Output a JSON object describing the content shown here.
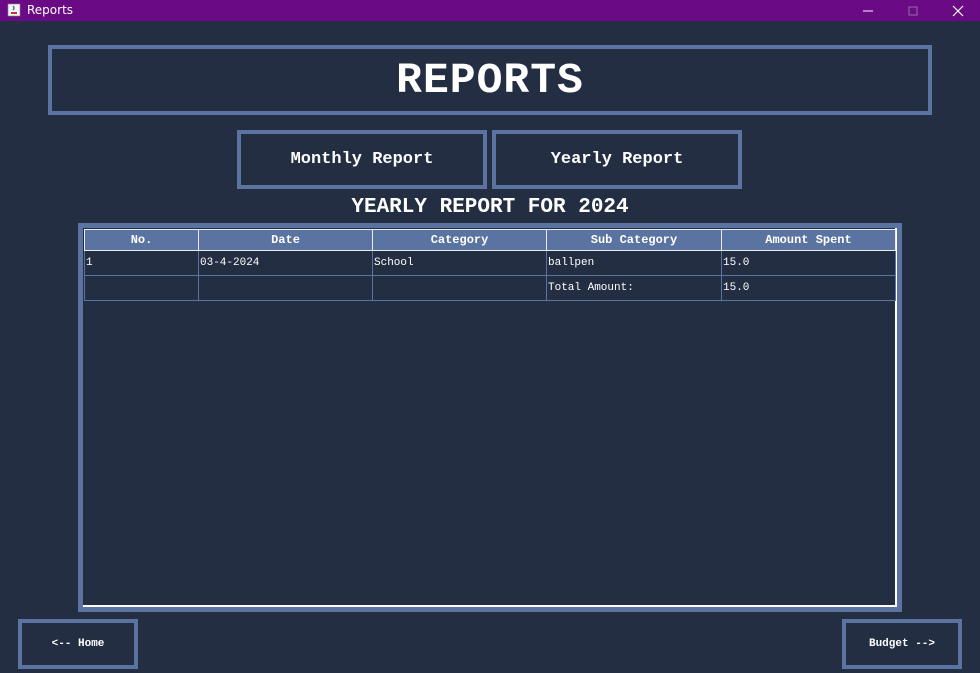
{
  "window": {
    "title": "Reports",
    "controls": {
      "minimize": "minimize-icon",
      "maximize": "maximize-icon",
      "close": "close-icon"
    }
  },
  "header": {
    "title": "REPORTS"
  },
  "tabs": {
    "monthly_label": "Monthly Report",
    "yearly_label": "Yearly Report"
  },
  "report": {
    "heading": "YEARLY REPORT FOR 2024",
    "columns": [
      "No.",
      "Date",
      "Category",
      "Sub Category",
      "Amount Spent"
    ],
    "rows": [
      [
        "1",
        "03-4-2024",
        "School",
        "ballpen",
        "15.0"
      ],
      [
        "",
        "",
        "",
        "Total Amount:",
        "15.0"
      ]
    ]
  },
  "nav": {
    "home_label": "<-- Home",
    "budget_label": "Budget -->"
  },
  "colors": {
    "background": "#232e42",
    "titlebar": "#6a0a84",
    "accent": "#5a73a0",
    "text": "#ffffff"
  }
}
